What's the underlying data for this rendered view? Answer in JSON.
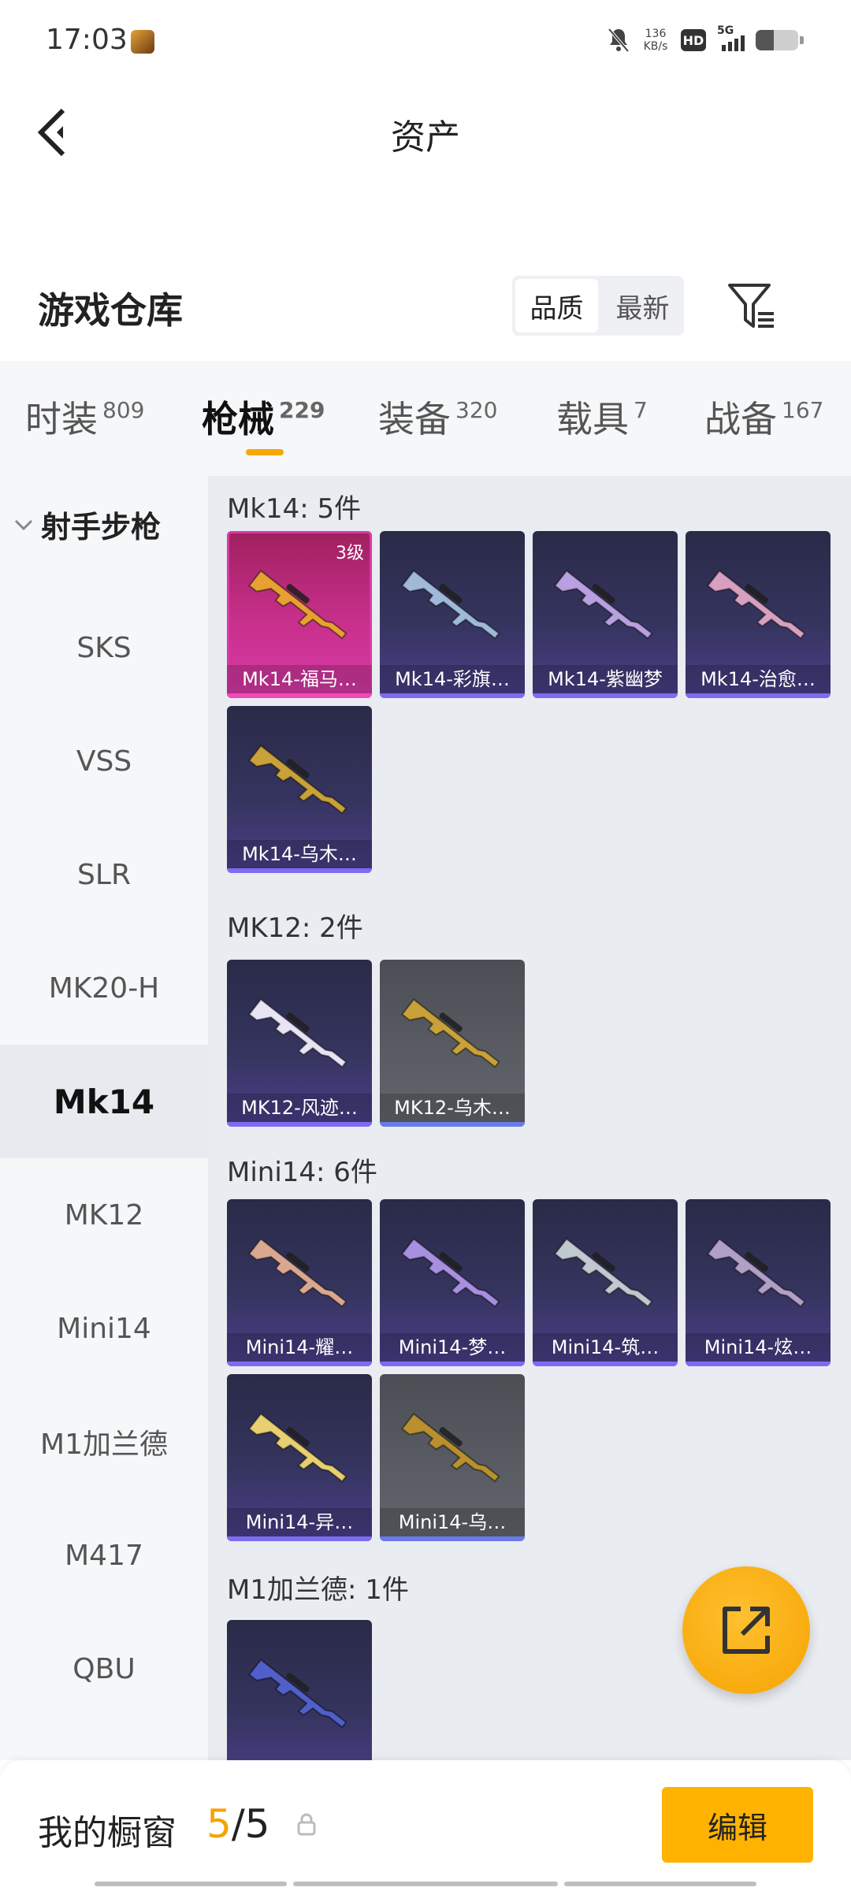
{
  "status_bar": {
    "time": "17:03",
    "net_speed_value": "136",
    "net_speed_unit": "KB/s",
    "hd": "HD",
    "network": "5G",
    "battery_level": 0.42
  },
  "header": {
    "title": "资产"
  },
  "warehouse": {
    "title": "游戏仓库",
    "sort_options": [
      "品质",
      "最新"
    ],
    "sort_selected": "品质"
  },
  "tabs": [
    {
      "label": "时装",
      "count": "809"
    },
    {
      "label": "枪械",
      "count": "229"
    },
    {
      "label": "装备",
      "count": "320"
    },
    {
      "label": "载具",
      "count": "7"
    },
    {
      "label": "战备",
      "count": "167"
    }
  ],
  "sidebar": {
    "group": "射手步枪",
    "items": [
      "SKS",
      "VSS",
      "SLR",
      "MK20-H",
      "Mk14",
      "MK12",
      "Mini14",
      "M1加兰德",
      "M417",
      "QBU"
    ],
    "active": "Mk14"
  },
  "sections": [
    {
      "title": "Mk14: 5件",
      "items": [
        {
          "name": "Mk14-福马…",
          "level": "3级",
          "tier": "gold",
          "color": "#e8a030"
        },
        {
          "name": "Mk14-彩旗…",
          "tier": "purple",
          "color": "#9fb9d8"
        },
        {
          "name": "Mk14-紫幽梦",
          "tier": "purple",
          "color": "#b9a0e0"
        },
        {
          "name": "Mk14-治愈…",
          "tier": "purple",
          "color": "#d8a0c0"
        },
        {
          "name": "Mk14-乌木…",
          "tier": "purple",
          "color": "#c9a13a"
        }
      ]
    },
    {
      "title": "MK12: 2件",
      "items": [
        {
          "name": "MK12-风迹…",
          "tier": "purple",
          "color": "#e8e4f4"
        },
        {
          "name": "MK12-乌木…",
          "tier": "grey",
          "color": "#c9a13a"
        }
      ]
    },
    {
      "title": "Mini14: 6件",
      "items": [
        {
          "name": "Mini14-耀…",
          "tier": "purple",
          "color": "#d8a890"
        },
        {
          "name": "Mini14-梦…",
          "tier": "purple",
          "color": "#a890e0"
        },
        {
          "name": "Mini14-筑…",
          "tier": "purple",
          "color": "#c0c8d0"
        },
        {
          "name": "Mini14-炫…",
          "tier": "purple",
          "color": "#b0a0c8"
        },
        {
          "name": "Mini14-异…",
          "tier": "purple",
          "color": "#e8d070"
        },
        {
          "name": "Mini14-乌…",
          "tier": "grey",
          "color": "#b89030"
        }
      ]
    },
    {
      "title": "M1加兰德: 1件",
      "items": [
        {
          "name": "",
          "tier": "purple",
          "color": "#5060c8"
        }
      ]
    }
  ],
  "bottom_bar": {
    "label": "我的橱窗",
    "count_current": "5",
    "count_separator": "/",
    "count_total": "5",
    "edit_label": "编辑"
  },
  "colors": {
    "accent": "#f5a300",
    "rare_purple": "#7b6cf2",
    "legendary_pink": "#f04ab8"
  },
  "icons": {
    "back": "chevron-left-icon",
    "filter": "filter-icon",
    "share": "share-external-icon",
    "lock": "lock-icon"
  }
}
